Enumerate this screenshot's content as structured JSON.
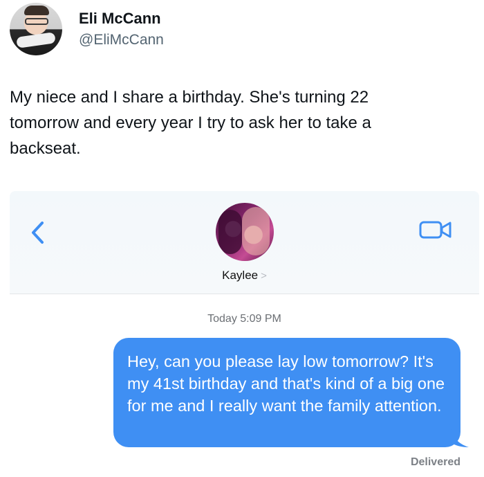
{
  "tweet": {
    "author_name": "Eli McCann",
    "author_handle": "@EliMcCann",
    "text": "My niece and I share a birthday. She's turning 22\ntomorrow and every year I try to ask her to take a\nbackseat."
  },
  "messages_screenshot": {
    "contact_name": "Kaylee",
    "contact_chevron": ">",
    "timestamp": "Today 5:09 PM",
    "bubble_text": "Hey, can you please lay low tomorrow? It's my 41st birthday and that's kind of a big one for me and I really want the family attention.",
    "status": "Delivered",
    "icons": {
      "back": "chevron-left-icon",
      "video": "video-camera-icon"
    },
    "colors": {
      "accent": "#3f8ff3",
      "bubble": "#3f8ff3"
    }
  }
}
